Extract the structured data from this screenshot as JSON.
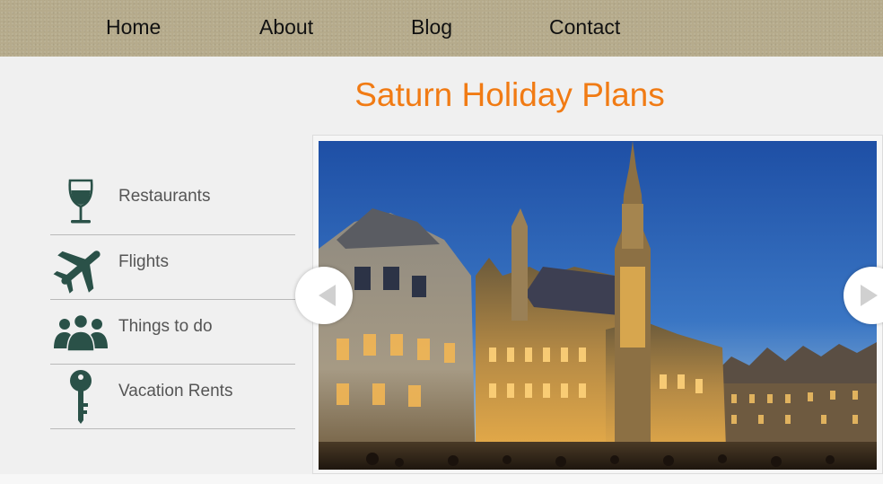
{
  "nav": {
    "items": [
      {
        "label": "Home"
      },
      {
        "label": "About"
      },
      {
        "label": "Blog"
      },
      {
        "label": "Contact"
      }
    ]
  },
  "page": {
    "title": "Saturn Holiday Plans"
  },
  "sidebar": {
    "items": [
      {
        "label": "Restaurants",
        "icon": "wine-glass-icon"
      },
      {
        "label": "Flights",
        "icon": "airplane-icon"
      },
      {
        "label": "Things to do",
        "icon": "people-group-icon"
      },
      {
        "label": "Vacation Rents",
        "icon": "key-icon"
      }
    ]
  },
  "slider": {
    "image": "night-city-square-gothic-building-photo",
    "prev_icon": "chevron-left-icon",
    "next_icon": "chevron-right-icon"
  },
  "colors": {
    "nav_background": "#b6ab8c",
    "title": "#f17b14",
    "icon": "#2a5148",
    "sidebar_text": "#555555"
  }
}
